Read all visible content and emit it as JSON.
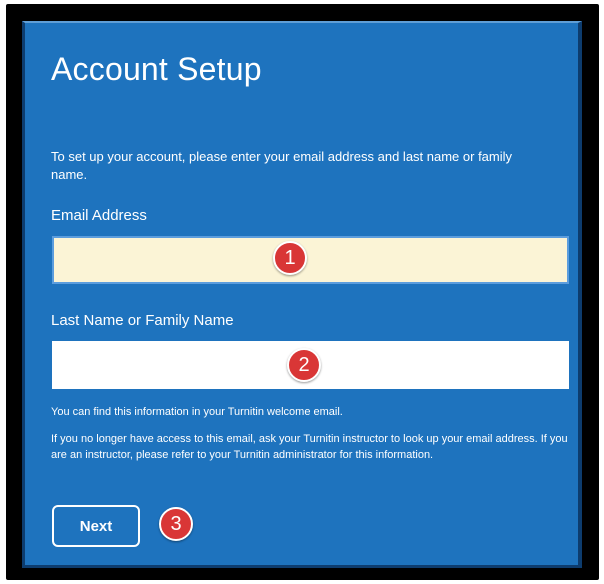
{
  "page": {
    "title": "Account Setup",
    "intro": "To set up your account, please enter your email address and last name or family name."
  },
  "form": {
    "email_label": "Email Address",
    "email_value": "",
    "last_name_label": "Last Name or Family Name",
    "last_name_value": "",
    "info_line_1": "You can find this information in your Turnitin welcome email.",
    "info_line_2": "If you no longer have access to this email, ask your Turnitin instructor to look up your email address. If you are an instructor, please refer to your Turnitin administrator for this information.",
    "next_label": "Next"
  },
  "markers": [
    "1",
    "2",
    "3"
  ],
  "colors": {
    "panel_background": "#1e73be",
    "email_field_background": "#fbf4d6",
    "marker": "#d93636"
  }
}
